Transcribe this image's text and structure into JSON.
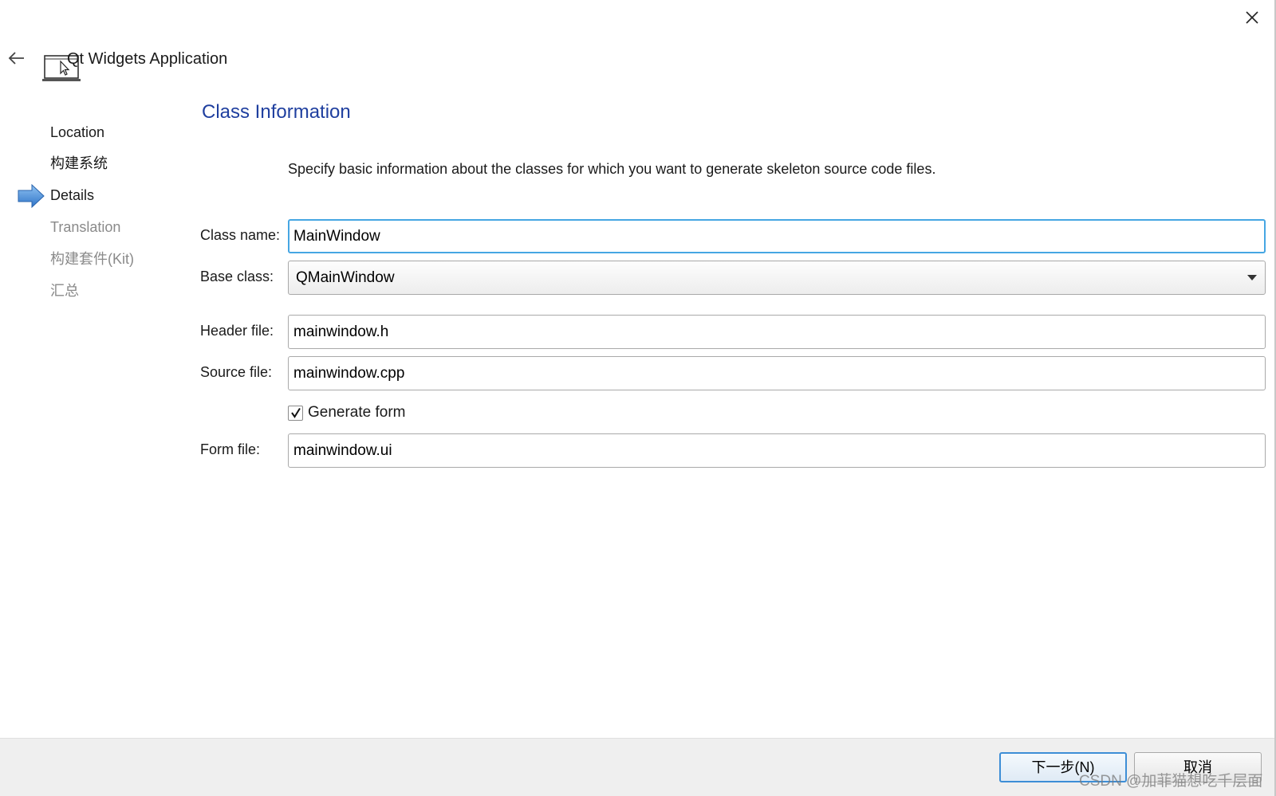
{
  "window": {
    "title": "Qt Widgets Application",
    "close_icon": "close-icon",
    "back_icon": "arrow-left-icon",
    "app_icon": "laptop-cursor-icon"
  },
  "steps": [
    {
      "label": "Location",
      "state": "done"
    },
    {
      "label": "构建系统",
      "state": "done"
    },
    {
      "label": "Details",
      "state": "current"
    },
    {
      "label": "Translation",
      "state": "pending"
    },
    {
      "label": "构建套件(Kit)",
      "state": "pending"
    },
    {
      "label": "汇总",
      "state": "pending"
    }
  ],
  "page": {
    "title": "Class Information",
    "description": "Specify basic information about the classes for which you want to generate skeleton source code files."
  },
  "form": {
    "class_name_label": "Class name:",
    "class_name_value": "MainWindow",
    "base_class_label": "Base class:",
    "base_class_value": "QMainWindow",
    "header_file_label": "Header file:",
    "header_file_value": "mainwindow.h",
    "source_file_label": "Source file:",
    "source_file_value": "mainwindow.cpp",
    "generate_form_label": "Generate form",
    "generate_form_checked": true,
    "form_file_label": "Form file:",
    "form_file_value": "mainwindow.ui"
  },
  "footer": {
    "next_label": "下一步(N)",
    "cancel_label": "取消"
  },
  "watermark": "CSDN @加菲猫想吃千层面",
  "colors": {
    "accent": "#1f3f9f",
    "focus_border": "#46a6e3",
    "step_arrow": "#3b86d8",
    "footer_bg": "#efefef"
  }
}
